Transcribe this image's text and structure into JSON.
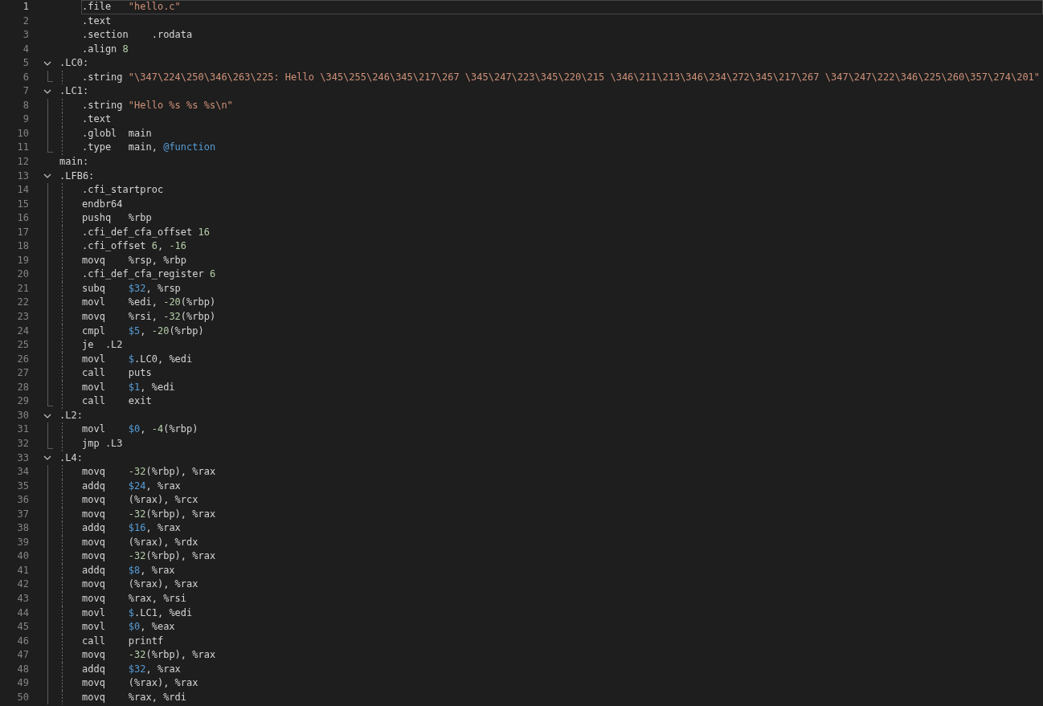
{
  "editor": {
    "lines": [
      {
        "number": "1",
        "kind": "code",
        "current": true,
        "tokens": [
          {
            "kind": "text",
            "text": ".file   "
          },
          {
            "kind": "str",
            "text": "\"hello.c\""
          }
        ]
      },
      {
        "number": "2",
        "kind": "code",
        "tokens": [
          {
            "kind": "text",
            "text": ".text"
          }
        ]
      },
      {
        "number": "3",
        "kind": "code",
        "tokens": [
          {
            "kind": "text",
            "text": ".section    .rodata"
          }
        ]
      },
      {
        "number": "4",
        "kind": "code",
        "tokens": [
          {
            "kind": "text",
            "text": ".align "
          },
          {
            "kind": "num",
            "text": "8"
          }
        ]
      },
      {
        "number": "5",
        "kind": "label",
        "expanded": true,
        "tokens": [
          {
            "kind": "text",
            "text": ".LC0:"
          }
        ],
        "children": [
          {
            "number": "6",
            "kind": "code",
            "tokens": [
              {
                "kind": "text",
                "text": ".string "
              },
              {
                "kind": "str",
                "text": "\"\\347\\224\\250\\346\\263\\225: Hello \\345\\255\\246\\345\\217\\267 \\345\\247\\223\\345\\220\\215 \\346\\211\\213\\346\\234\\272\\345\\217\\267 \\347\\247\\222\\346\\225\\260\\357\\274\\201\""
              }
            ]
          }
        ]
      },
      {
        "number": "7",
        "kind": "label",
        "expanded": true,
        "tokens": [
          {
            "kind": "text",
            "text": ".LC1:"
          }
        ],
        "children": [
          {
            "number": "8",
            "kind": "code",
            "tokens": [
              {
                "kind": "text",
                "text": ".string "
              },
              {
                "kind": "str",
                "text": "\"Hello %s %s %s\\n\""
              }
            ]
          },
          {
            "number": "9",
            "kind": "code",
            "tokens": [
              {
                "kind": "text",
                "text": ".text"
              }
            ]
          },
          {
            "number": "10",
            "kind": "code",
            "tokens": [
              {
                "kind": "text",
                "text": ".globl  main"
              }
            ]
          },
          {
            "number": "11",
            "kind": "code",
            "tokens": [
              {
                "kind": "text",
                "text": ".type   main, "
              },
              {
                "kind": "sym",
                "text": "@function"
              }
            ]
          }
        ]
      },
      {
        "number": "12",
        "kind": "label",
        "tokens": [
          {
            "kind": "text",
            "text": "main:"
          }
        ]
      },
      {
        "number": "13",
        "kind": "label",
        "expanded": true,
        "tokens": [
          {
            "kind": "text",
            "text": ".LFB6:"
          }
        ],
        "children": [
          {
            "number": "14",
            "kind": "code",
            "tokens": [
              {
                "kind": "text",
                "text": ".cfi_startproc"
              }
            ]
          },
          {
            "number": "15",
            "kind": "code",
            "tokens": [
              {
                "kind": "text",
                "text": "endbr64"
              }
            ]
          },
          {
            "number": "16",
            "kind": "code",
            "tokens": [
              {
                "kind": "text",
                "text": "pushq   %rbp"
              }
            ]
          },
          {
            "number": "17",
            "kind": "code",
            "tokens": [
              {
                "kind": "text",
                "text": ".cfi_def_cfa_offset "
              },
              {
                "kind": "num",
                "text": "16"
              }
            ]
          },
          {
            "number": "18",
            "kind": "code",
            "tokens": [
              {
                "kind": "text",
                "text": ".cfi_offset "
              },
              {
                "kind": "num",
                "text": "6"
              },
              {
                "kind": "text",
                "text": ", "
              },
              {
                "kind": "num",
                "text": "-16"
              }
            ]
          },
          {
            "number": "19",
            "kind": "code",
            "tokens": [
              {
                "kind": "text",
                "text": "movq    %rsp, %rbp"
              }
            ]
          },
          {
            "number": "20",
            "kind": "code",
            "tokens": [
              {
                "kind": "text",
                "text": ".cfi_def_cfa_register "
              },
              {
                "kind": "num",
                "text": "6"
              }
            ]
          },
          {
            "number": "21",
            "kind": "code",
            "tokens": [
              {
                "kind": "text",
                "text": "subq    "
              },
              {
                "kind": "sym",
                "text": "$32"
              },
              {
                "kind": "text",
                "text": ", %rsp"
              }
            ]
          },
          {
            "number": "22",
            "kind": "code",
            "tokens": [
              {
                "kind": "text",
                "text": "movl    %edi, "
              },
              {
                "kind": "num",
                "text": "-20"
              },
              {
                "kind": "text",
                "text": "(%rbp)"
              }
            ]
          },
          {
            "number": "23",
            "kind": "code",
            "tokens": [
              {
                "kind": "text",
                "text": "movq    %rsi, "
              },
              {
                "kind": "num",
                "text": "-32"
              },
              {
                "kind": "text",
                "text": "(%rbp)"
              }
            ]
          },
          {
            "number": "24",
            "kind": "code",
            "tokens": [
              {
                "kind": "text",
                "text": "cmpl    "
              },
              {
                "kind": "sym",
                "text": "$5"
              },
              {
                "kind": "text",
                "text": ", "
              },
              {
                "kind": "num",
                "text": "-20"
              },
              {
                "kind": "text",
                "text": "(%rbp)"
              }
            ]
          },
          {
            "number": "25",
            "kind": "code",
            "tokens": [
              {
                "kind": "text",
                "text": "je  .L2"
              }
            ]
          },
          {
            "number": "26",
            "kind": "code",
            "tokens": [
              {
                "kind": "text",
                "text": "movl    "
              },
              {
                "kind": "sym",
                "text": "$"
              },
              {
                "kind": "text",
                "text": ".LC0, %edi"
              }
            ]
          },
          {
            "number": "27",
            "kind": "code",
            "tokens": [
              {
                "kind": "text",
                "text": "call    puts"
              }
            ]
          },
          {
            "number": "28",
            "kind": "code",
            "tokens": [
              {
                "kind": "text",
                "text": "movl    "
              },
              {
                "kind": "sym",
                "text": "$1"
              },
              {
                "kind": "text",
                "text": ", %edi"
              }
            ]
          },
          {
            "number": "29",
            "kind": "code",
            "tokens": [
              {
                "kind": "text",
                "text": "call    exit"
              }
            ]
          }
        ]
      },
      {
        "number": "30",
        "kind": "label",
        "expanded": true,
        "tokens": [
          {
            "kind": "text",
            "text": ".L2:"
          }
        ],
        "children": [
          {
            "number": "31",
            "kind": "code",
            "tokens": [
              {
                "kind": "text",
                "text": "movl    "
              },
              {
                "kind": "sym",
                "text": "$0"
              },
              {
                "kind": "text",
                "text": ", "
              },
              {
                "kind": "num",
                "text": "-4"
              },
              {
                "kind": "text",
                "text": "(%rbp)"
              }
            ]
          },
          {
            "number": "32",
            "kind": "code",
            "tokens": [
              {
                "kind": "text",
                "text": "jmp .L3"
              }
            ]
          }
        ]
      },
      {
        "number": "33",
        "kind": "label",
        "expanded": true,
        "tokens": [
          {
            "kind": "text",
            "text": ".L4:"
          }
        ],
        "children": [
          {
            "number": "34",
            "kind": "code",
            "tokens": [
              {
                "kind": "text",
                "text": "movq    "
              },
              {
                "kind": "num",
                "text": "-32"
              },
              {
                "kind": "text",
                "text": "(%rbp), %rax"
              }
            ]
          },
          {
            "number": "35",
            "kind": "code",
            "tokens": [
              {
                "kind": "text",
                "text": "addq    "
              },
              {
                "kind": "sym",
                "text": "$24"
              },
              {
                "kind": "text",
                "text": ", %rax"
              }
            ]
          },
          {
            "number": "36",
            "kind": "code",
            "tokens": [
              {
                "kind": "text",
                "text": "movq    (%rax), %rcx"
              }
            ]
          },
          {
            "number": "37",
            "kind": "code",
            "tokens": [
              {
                "kind": "text",
                "text": "movq    "
              },
              {
                "kind": "num",
                "text": "-32"
              },
              {
                "kind": "text",
                "text": "(%rbp), %rax"
              }
            ]
          },
          {
            "number": "38",
            "kind": "code",
            "tokens": [
              {
                "kind": "text",
                "text": "addq    "
              },
              {
                "kind": "sym",
                "text": "$16"
              },
              {
                "kind": "text",
                "text": ", %rax"
              }
            ]
          },
          {
            "number": "39",
            "kind": "code",
            "tokens": [
              {
                "kind": "text",
                "text": "movq    (%rax), %rdx"
              }
            ]
          },
          {
            "number": "40",
            "kind": "code",
            "tokens": [
              {
                "kind": "text",
                "text": "movq    "
              },
              {
                "kind": "num",
                "text": "-32"
              },
              {
                "kind": "text",
                "text": "(%rbp), %rax"
              }
            ]
          },
          {
            "number": "41",
            "kind": "code",
            "tokens": [
              {
                "kind": "text",
                "text": "addq    "
              },
              {
                "kind": "sym",
                "text": "$8"
              },
              {
                "kind": "text",
                "text": ", %rax"
              }
            ]
          },
          {
            "number": "42",
            "kind": "code",
            "tokens": [
              {
                "kind": "text",
                "text": "movq    (%rax), %rax"
              }
            ]
          },
          {
            "number": "43",
            "kind": "code",
            "tokens": [
              {
                "kind": "text",
                "text": "movq    %rax, %rsi"
              }
            ]
          },
          {
            "number": "44",
            "kind": "code",
            "tokens": [
              {
                "kind": "text",
                "text": "movl    "
              },
              {
                "kind": "sym",
                "text": "$"
              },
              {
                "kind": "text",
                "text": ".LC1, %edi"
              }
            ]
          },
          {
            "number": "45",
            "kind": "code",
            "tokens": [
              {
                "kind": "text",
                "text": "movl    "
              },
              {
                "kind": "sym",
                "text": "$0"
              },
              {
                "kind": "text",
                "text": ", %eax"
              }
            ]
          },
          {
            "number": "46",
            "kind": "code",
            "tokens": [
              {
                "kind": "text",
                "text": "call    printf"
              }
            ]
          },
          {
            "number": "47",
            "kind": "code",
            "tokens": [
              {
                "kind": "text",
                "text": "movq    "
              },
              {
                "kind": "num",
                "text": "-32"
              },
              {
                "kind": "text",
                "text": "(%rbp), %rax"
              }
            ]
          },
          {
            "number": "48",
            "kind": "code",
            "tokens": [
              {
                "kind": "text",
                "text": "addq    "
              },
              {
                "kind": "sym",
                "text": "$32"
              },
              {
                "kind": "text",
                "text": ", %rax"
              }
            ]
          },
          {
            "number": "49",
            "kind": "code",
            "tokens": [
              {
                "kind": "text",
                "text": "movq    (%rax), %rax"
              }
            ]
          },
          {
            "number": "50",
            "kind": "code",
            "tokens": [
              {
                "kind": "text",
                "text": "movq    %rax, %rdi"
              }
            ]
          }
        ]
      }
    ]
  }
}
